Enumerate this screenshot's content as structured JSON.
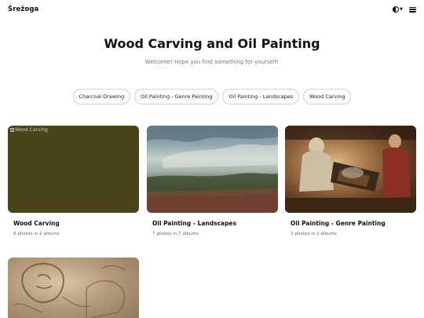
{
  "header": {
    "logo": "Śreżoga",
    "theme_icon": "half-circle-icon",
    "menu_icon": "hamburger-icon"
  },
  "hero": {
    "title": "Wood Carving and Oil Painting",
    "subtitle": "Welcome! Hope you find something for yourself!"
  },
  "tags": [
    "Charcoal Drawing",
    "Oil Painting - Genre Painting",
    "Oil Painting - Landscapes",
    "Wood Carving"
  ],
  "cards": [
    {
      "title": "Wood Carving",
      "meta": "6 photos in 2 albums",
      "image_alt": "Wood Carving"
    },
    {
      "title": "Oil Painting - Landscapes",
      "meta": "7 photos in 7 albums"
    },
    {
      "title": "Oil Painting - Genre Painting",
      "meta": "2 photos in 2 albums"
    },
    {
      "title": "",
      "meta": ""
    }
  ]
}
